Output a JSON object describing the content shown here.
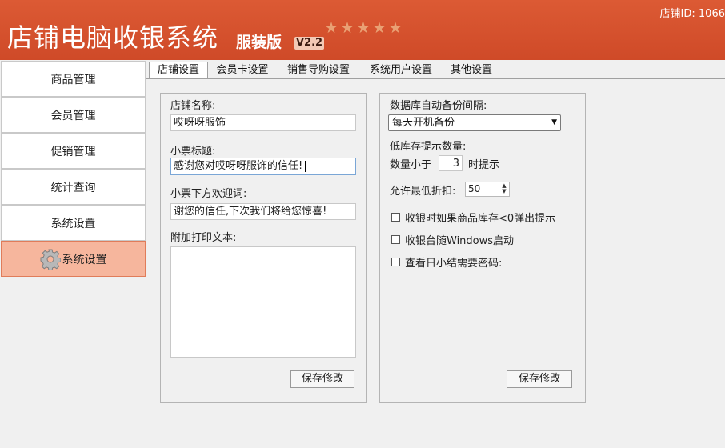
{
  "header": {
    "app_title": "店铺电脑收银系统",
    "edition": "服装版",
    "version": "V2.2",
    "store_id": "店铺ID: 1066"
  },
  "sidebar": {
    "items": [
      {
        "label": "商品管理"
      },
      {
        "label": "会员管理"
      },
      {
        "label": "促销管理"
      },
      {
        "label": "统计查询"
      },
      {
        "label": "系统设置"
      }
    ],
    "active_item": {
      "label": "系统设置",
      "icon": "gear-icon"
    }
  },
  "tabs": [
    {
      "label": "店铺设置"
    },
    {
      "label": "会员卡设置"
    },
    {
      "label": "销售导购设置"
    },
    {
      "label": "系统用户设置"
    },
    {
      "label": "其他设置"
    }
  ],
  "store_panel": {
    "store_name_label": "店铺名称:",
    "store_name_value": "哎呀呀服饰",
    "receipt_title_label": "小票标题:",
    "receipt_title_value": "感谢您对哎呀呀服饰的信任!",
    "receipt_welcome_label": "小票下方欢迎词:",
    "receipt_welcome_value": "谢您的信任,下次我们将给您惊喜!",
    "extra_print_label": "附加打印文本:",
    "extra_print_value": "",
    "save_label": "保存修改"
  },
  "system_panel": {
    "backup_label": "数据库自动备份间隔:",
    "backup_selected": "每天开机备份",
    "low_stock_label": "低库存提示数量:",
    "qty_prefix": "数量小于",
    "qty_value": "3",
    "qty_suffix": "时提示",
    "discount_label": "允许最低折扣:",
    "discount_value": "50",
    "check_negative_stock": "收银时如果商品库存<0弹出提示",
    "check_autostart": "收银台随Windows启动",
    "check_summary_password": "查看日小结需要密码:",
    "save_label": "保存修改"
  }
}
